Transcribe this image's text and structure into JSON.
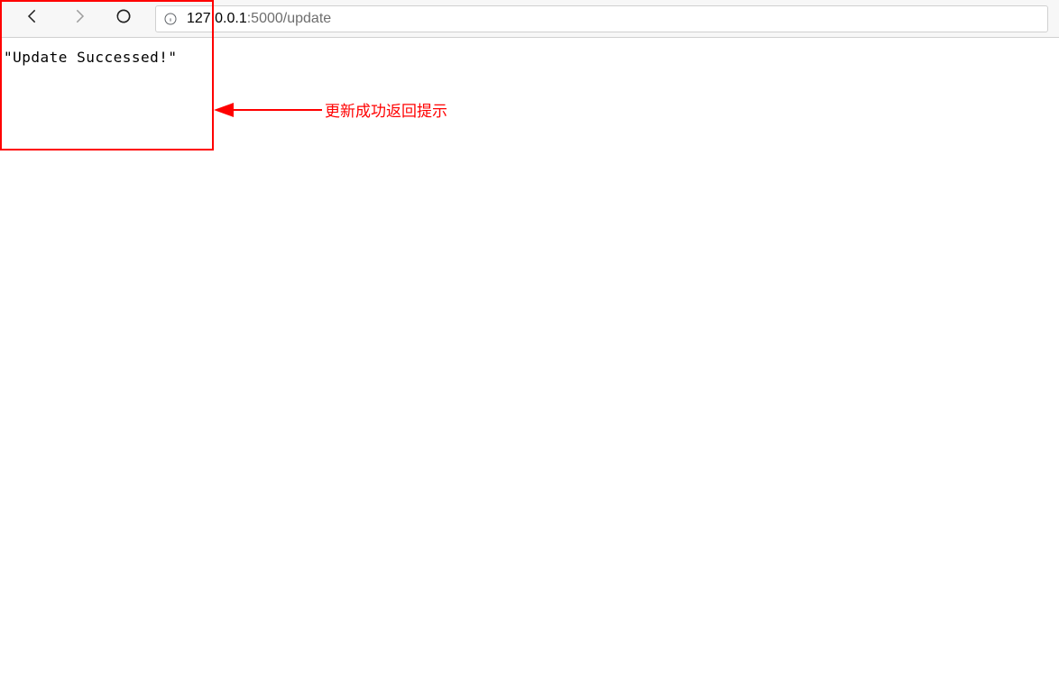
{
  "browser": {
    "url_host": "127.0.0.1",
    "url_rest": ":5000/update",
    "icons": {
      "back": "back-icon",
      "forward": "forward-icon",
      "reload": "reload-icon",
      "site_info": "info-icon"
    }
  },
  "page": {
    "body_text": "\"Update Successed!\""
  },
  "annotation": {
    "label": "更新成功返回提示",
    "box_color": "#ff0000"
  }
}
